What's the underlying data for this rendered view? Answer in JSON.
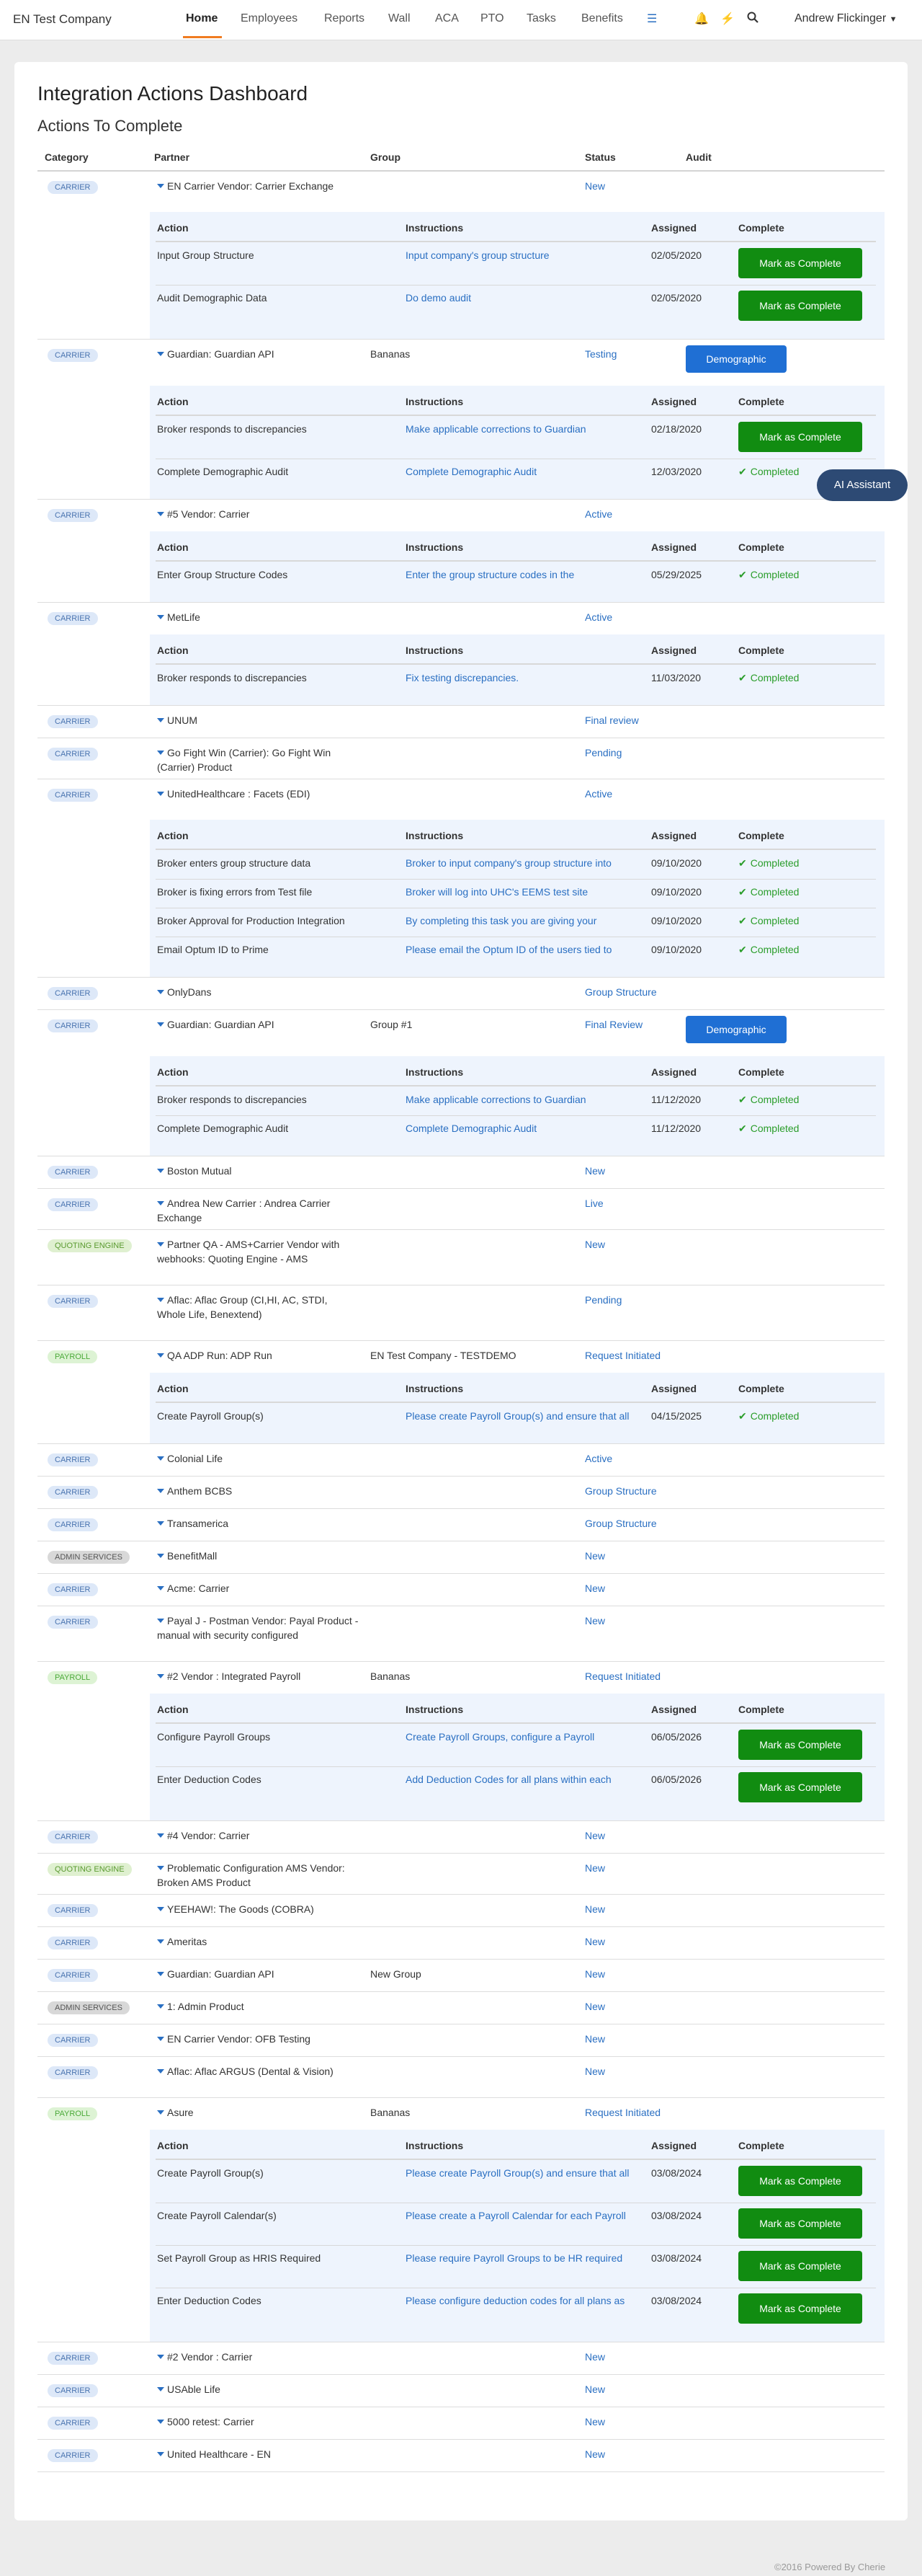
{
  "nav": {
    "brand": "EN Test Company",
    "items": [
      "Home",
      "Employees",
      "Reports",
      "Wall",
      "ACA",
      "PTO",
      "Tasks",
      "Benefits"
    ],
    "user": "Andrew Flickinger"
  },
  "page": {
    "title": "Integration Actions Dashboard",
    "subtitle": "Actions To Complete",
    "footer": "©2016 Powered By Cherie",
    "ai_assistant": "AI Assistant"
  },
  "columns": {
    "category": "Category",
    "partner": "Partner",
    "group": "Group",
    "status": "Status",
    "audit": "Audit"
  },
  "subcolumns": {
    "action": "Action",
    "instructions": "Instructions",
    "assigned": "Assigned",
    "complete": "Complete"
  },
  "labels": {
    "mark_complete": "Mark as Complete",
    "completed": "Completed"
  },
  "rows": [
    {
      "category": "CARRIER",
      "partner": "EN Carrier Vendor: Carrier Exchange",
      "group": "",
      "status": "New",
      "audit": "",
      "actions": [
        {
          "action": "Input Group Structure",
          "instructions": "Input company's group structure",
          "assigned": "02/05/2020",
          "done": false
        },
        {
          "action": "Audit Demographic Data",
          "instructions": "Do demo audit",
          "assigned": "02/05/2020",
          "done": false
        }
      ]
    },
    {
      "category": "CARRIER",
      "partner": "Guardian: Guardian API",
      "group": "Bananas",
      "status": "Testing",
      "audit": "Demographic",
      "actions": [
        {
          "action": "Broker responds to discrepancies",
          "instructions": "Make applicable corrections to Guardian",
          "assigned": "02/18/2020",
          "done": false
        },
        {
          "action": "Complete Demographic Audit",
          "instructions": "Complete Demographic Audit",
          "assigned": "12/03/2020",
          "done": true
        }
      ]
    },
    {
      "category": "CARRIER",
      "partner": "#5 Vendor: Carrier",
      "group": "",
      "status": "Active",
      "audit": "",
      "actions": [
        {
          "action": "Enter Group Structure Codes",
          "instructions": "Enter the group structure codes in the",
          "assigned": "05/29/2025",
          "done": true
        }
      ]
    },
    {
      "category": "CARRIER",
      "partner": "MetLife",
      "group": "",
      "status": "Active",
      "audit": "",
      "actions": [
        {
          "action": "Broker responds to discrepancies",
          "instructions": "Fix testing discrepancies.",
          "assigned": "11/03/2020",
          "done": true
        }
      ]
    },
    {
      "category": "CARRIER",
      "partner": "UNUM",
      "group": "",
      "status": "Final review",
      "audit": "",
      "actions": []
    },
    {
      "category": "CARRIER",
      "partner": "Go Fight Win (Carrier): Go Fight Win (Carrier) Product",
      "group": "",
      "status": "Pending",
      "audit": "",
      "actions": []
    },
    {
      "category": "CARRIER",
      "partner": "UnitedHealthcare : Facets (EDI)",
      "group": "",
      "status": "Active",
      "audit": "",
      "actions": [
        {
          "action": "Broker enters group structure data",
          "instructions": "Broker to input company's group structure into",
          "assigned": "09/10/2020",
          "done": true
        },
        {
          "action": "Broker is fixing errors from Test file",
          "instructions": "Broker will log into UHC's EEMS test site",
          "assigned": "09/10/2020",
          "done": true
        },
        {
          "action": "Broker Approval for Production Integration",
          "instructions": "By completing this task you are giving your",
          "assigned": "09/10/2020",
          "done": true
        },
        {
          "action": "Email Optum ID to Prime",
          "instructions": "Please email the Optum ID of the users tied to",
          "assigned": "09/10/2020",
          "done": true
        }
      ]
    },
    {
      "category": "CARRIER",
      "partner": "OnlyDans",
      "group": "",
      "status": "Group Structure",
      "audit": "",
      "actions": []
    },
    {
      "category": "CARRIER",
      "partner": "Guardian: Guardian API",
      "group": "Group #1",
      "status": "Final Review",
      "audit": "Demographic",
      "actions": [
        {
          "action": "Broker responds to discrepancies",
          "instructions": "Make applicable corrections to Guardian",
          "assigned": "11/12/2020",
          "done": true
        },
        {
          "action": "Complete Demographic Audit",
          "instructions": "Complete Demographic Audit",
          "assigned": "11/12/2020",
          "done": true
        }
      ]
    },
    {
      "category": "CARRIER",
      "partner": "Boston Mutual",
      "group": "",
      "status": "New",
      "audit": "",
      "actions": []
    },
    {
      "category": "CARRIER",
      "partner": "Andrea New Carrier : Andrea Carrier Exchange",
      "group": "",
      "status": "Live",
      "audit": "",
      "actions": []
    },
    {
      "category": "QUOTING ENGINE",
      "partner": "Partner QA - AMS+Carrier Vendor with webhooks: Quoting Engine - AMS",
      "group": "",
      "status": "New",
      "audit": "",
      "actions": []
    },
    {
      "category": "CARRIER",
      "partner": "Aflac: Aflac Group (CI,HI, AC, STDI, Whole Life, Benextend)",
      "group": "",
      "status": "Pending",
      "audit": "",
      "actions": []
    },
    {
      "category": "PAYROLL",
      "partner": "QA ADP Run: ADP Run",
      "group": "EN Test Company - TESTDEMO",
      "status": "Request Initiated",
      "audit": "",
      "actions": [
        {
          "action": "Create Payroll Group(s)",
          "instructions": "Please create Payroll Group(s) and ensure that all",
          "assigned": "04/15/2025",
          "done": true
        }
      ]
    },
    {
      "category": "CARRIER",
      "partner": "Colonial Life",
      "group": "",
      "status": "Active",
      "audit": "",
      "actions": []
    },
    {
      "category": "CARRIER",
      "partner": "Anthem BCBS",
      "group": "",
      "status": "Group Structure",
      "audit": "",
      "actions": []
    },
    {
      "category": "CARRIER",
      "partner": "Transamerica",
      "group": "",
      "status": "Group Structure",
      "audit": "",
      "actions": []
    },
    {
      "category": "ADMIN SERVICES",
      "partner": "BenefitMall",
      "group": "",
      "status": "New",
      "audit": "",
      "actions": []
    },
    {
      "category": "CARRIER",
      "partner": "Acme: Carrier",
      "group": "",
      "status": "New",
      "audit": "",
      "actions": []
    },
    {
      "category": "CARRIER",
      "partner": "Payal J - Postman Vendor: Payal Product - manual with security configured",
      "group": "",
      "status": "New",
      "audit": "",
      "actions": []
    },
    {
      "category": "PAYROLL",
      "partner": "#2 Vendor : Integrated Payroll",
      "group": "Bananas",
      "status": "Request Initiated",
      "audit": "",
      "actions": [
        {
          "action": "Configure Payroll Groups",
          "instructions": "Create Payroll Groups, configure a Payroll",
          "assigned": "06/05/2026",
          "done": false
        },
        {
          "action": "Enter Deduction Codes",
          "instructions": "Add Deduction Codes for all plans within each",
          "assigned": "06/05/2026",
          "done": false
        }
      ]
    },
    {
      "category": "CARRIER",
      "partner": "#4 Vendor: Carrier",
      "group": "",
      "status": "New",
      "audit": "",
      "actions": []
    },
    {
      "category": "QUOTING ENGINE",
      "partner": "Problematic Configuration AMS Vendor: Broken AMS Product",
      "group": "",
      "status": "New",
      "audit": "",
      "actions": []
    },
    {
      "category": "CARRIER",
      "partner": "YEEHAW!: The Goods (COBRA)",
      "group": "",
      "status": "New",
      "audit": "",
      "actions": []
    },
    {
      "category": "CARRIER",
      "partner": "Ameritas",
      "group": "",
      "status": "New",
      "audit": "",
      "actions": []
    },
    {
      "category": "CARRIER",
      "partner": "Guardian: Guardian API",
      "group": "New Group",
      "status": "New",
      "audit": "",
      "actions": []
    },
    {
      "category": "ADMIN SERVICES",
      "partner": "1: Admin Product",
      "group": "",
      "status": "New",
      "audit": "",
      "actions": []
    },
    {
      "category": "CARRIER",
      "partner": "EN Carrier Vendor: OFB Testing",
      "group": "",
      "status": "New",
      "audit": "",
      "actions": []
    },
    {
      "category": "CARRIER",
      "partner": "Aflac: Aflac ARGUS (Dental & Vision)",
      "group": "",
      "status": "New",
      "audit": "",
      "actions": []
    },
    {
      "category": "PAYROLL",
      "partner": "Asure",
      "group": "Bananas",
      "status": "Request Initiated",
      "audit": "",
      "actions": [
        {
          "action": "Create Payroll Group(s)",
          "instructions": "Please create Payroll Group(s) and ensure that all",
          "assigned": "03/08/2024",
          "done": false
        },
        {
          "action": "Create Payroll Calendar(s)",
          "instructions": "Please create a Payroll Calendar for each Payroll",
          "assigned": "03/08/2024",
          "done": false
        },
        {
          "action": "Set Payroll Group as HRIS Required",
          "instructions": "Please require Payroll Groups to be HR required",
          "assigned": "03/08/2024",
          "done": false
        },
        {
          "action": "Enter Deduction Codes",
          "instructions": "Please configure deduction codes for all plans as",
          "assigned": "03/08/2024",
          "done": false
        }
      ]
    },
    {
      "category": "CARRIER",
      "partner": "#2 Vendor : Carrier",
      "group": "",
      "status": "New",
      "audit": "",
      "actions": []
    },
    {
      "category": "CARRIER",
      "partner": "USAble Life",
      "group": "",
      "status": "New",
      "audit": "",
      "actions": []
    },
    {
      "category": "CARRIER",
      "partner": "5000 retest: Carrier",
      "group": "",
      "status": "New",
      "audit": "",
      "actions": []
    },
    {
      "category": "CARRIER",
      "partner": "United Healthcare - EN",
      "group": "",
      "status": "New",
      "audit": "",
      "actions": []
    }
  ]
}
